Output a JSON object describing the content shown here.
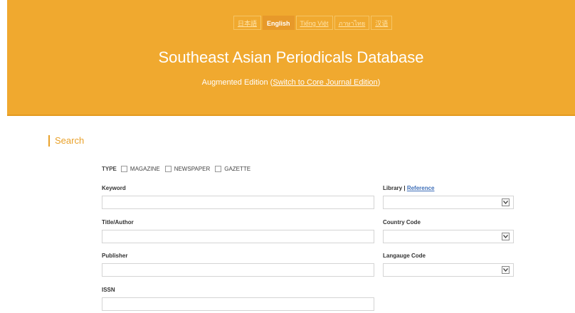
{
  "header": {
    "languages": [
      "日本語",
      "English",
      "Tiếng Việt",
      "ภาษาไทย",
      "汉语"
    ],
    "active_language": "English",
    "title": "Southeast Asian Periodicals Database",
    "subtitle_prefix": "Augmented Edition (",
    "subtitle_link": "Switch to Core Journal Edition",
    "subtitle_suffix": ")"
  },
  "search": {
    "heading": "Search",
    "type_label": "TYPE",
    "types": [
      "MAGAZINE",
      "NEWSPAPER",
      "GAZETTE"
    ],
    "fields": {
      "keyword": {
        "label": "Keyword",
        "value": "",
        "placeholder": ""
      },
      "title_author": {
        "label": "Title/Author",
        "value": "",
        "placeholder": ""
      },
      "publisher": {
        "label": "Publisher",
        "value": "",
        "placeholder": ""
      },
      "issn": {
        "label": "ISSN",
        "value": "",
        "placeholder": ""
      }
    },
    "selects": {
      "library": {
        "label": "Library",
        "separator": " | ",
        "link": "Reference",
        "selected": ""
      },
      "country": {
        "label": "Country Code",
        "selected": ""
      },
      "language": {
        "label": "Langauge Code",
        "selected": ""
      }
    }
  },
  "colors": {
    "accent": "#f0a92f",
    "link": "#3f6fb8"
  }
}
